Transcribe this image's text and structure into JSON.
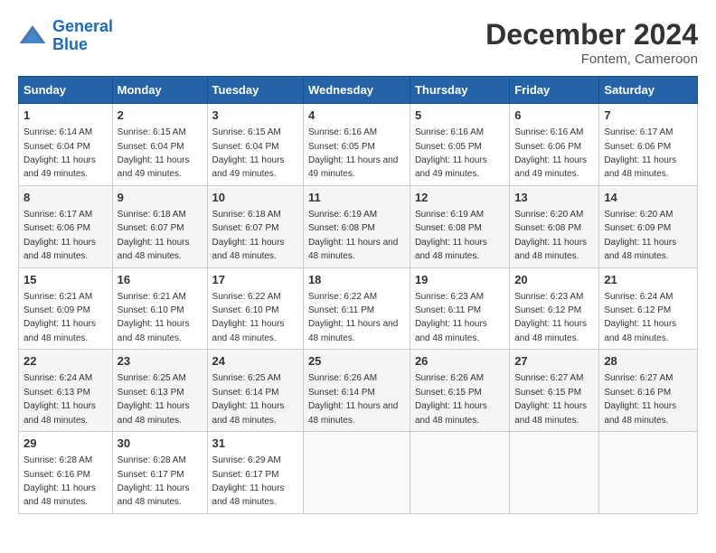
{
  "header": {
    "logo_line1": "General",
    "logo_line2": "Blue",
    "month_title": "December 2024",
    "location": "Fontem, Cameroon"
  },
  "weekdays": [
    "Sunday",
    "Monday",
    "Tuesday",
    "Wednesday",
    "Thursday",
    "Friday",
    "Saturday"
  ],
  "weeks": [
    [
      {
        "day": 1,
        "sunrise": "6:14 AM",
        "sunset": "6:04 PM",
        "daylight": "11 hours and 49 minutes."
      },
      {
        "day": 2,
        "sunrise": "6:15 AM",
        "sunset": "6:04 PM",
        "daylight": "11 hours and 49 minutes."
      },
      {
        "day": 3,
        "sunrise": "6:15 AM",
        "sunset": "6:04 PM",
        "daylight": "11 hours and 49 minutes."
      },
      {
        "day": 4,
        "sunrise": "6:16 AM",
        "sunset": "6:05 PM",
        "daylight": "11 hours and 49 minutes."
      },
      {
        "day": 5,
        "sunrise": "6:16 AM",
        "sunset": "6:05 PM",
        "daylight": "11 hours and 49 minutes."
      },
      {
        "day": 6,
        "sunrise": "6:16 AM",
        "sunset": "6:06 PM",
        "daylight": "11 hours and 49 minutes."
      },
      {
        "day": 7,
        "sunrise": "6:17 AM",
        "sunset": "6:06 PM",
        "daylight": "11 hours and 48 minutes."
      }
    ],
    [
      {
        "day": 8,
        "sunrise": "6:17 AM",
        "sunset": "6:06 PM",
        "daylight": "11 hours and 48 minutes."
      },
      {
        "day": 9,
        "sunrise": "6:18 AM",
        "sunset": "6:07 PM",
        "daylight": "11 hours and 48 minutes."
      },
      {
        "day": 10,
        "sunrise": "6:18 AM",
        "sunset": "6:07 PM",
        "daylight": "11 hours and 48 minutes."
      },
      {
        "day": 11,
        "sunrise": "6:19 AM",
        "sunset": "6:08 PM",
        "daylight": "11 hours and 48 minutes."
      },
      {
        "day": 12,
        "sunrise": "6:19 AM",
        "sunset": "6:08 PM",
        "daylight": "11 hours and 48 minutes."
      },
      {
        "day": 13,
        "sunrise": "6:20 AM",
        "sunset": "6:08 PM",
        "daylight": "11 hours and 48 minutes."
      },
      {
        "day": 14,
        "sunrise": "6:20 AM",
        "sunset": "6:09 PM",
        "daylight": "11 hours and 48 minutes."
      }
    ],
    [
      {
        "day": 15,
        "sunrise": "6:21 AM",
        "sunset": "6:09 PM",
        "daylight": "11 hours and 48 minutes."
      },
      {
        "day": 16,
        "sunrise": "6:21 AM",
        "sunset": "6:10 PM",
        "daylight": "11 hours and 48 minutes."
      },
      {
        "day": 17,
        "sunrise": "6:22 AM",
        "sunset": "6:10 PM",
        "daylight": "11 hours and 48 minutes."
      },
      {
        "day": 18,
        "sunrise": "6:22 AM",
        "sunset": "6:11 PM",
        "daylight": "11 hours and 48 minutes."
      },
      {
        "day": 19,
        "sunrise": "6:23 AM",
        "sunset": "6:11 PM",
        "daylight": "11 hours and 48 minutes."
      },
      {
        "day": 20,
        "sunrise": "6:23 AM",
        "sunset": "6:12 PM",
        "daylight": "11 hours and 48 minutes."
      },
      {
        "day": 21,
        "sunrise": "6:24 AM",
        "sunset": "6:12 PM",
        "daylight": "11 hours and 48 minutes."
      }
    ],
    [
      {
        "day": 22,
        "sunrise": "6:24 AM",
        "sunset": "6:13 PM",
        "daylight": "11 hours and 48 minutes."
      },
      {
        "day": 23,
        "sunrise": "6:25 AM",
        "sunset": "6:13 PM",
        "daylight": "11 hours and 48 minutes."
      },
      {
        "day": 24,
        "sunrise": "6:25 AM",
        "sunset": "6:14 PM",
        "daylight": "11 hours and 48 minutes."
      },
      {
        "day": 25,
        "sunrise": "6:26 AM",
        "sunset": "6:14 PM",
        "daylight": "11 hours and 48 minutes."
      },
      {
        "day": 26,
        "sunrise": "6:26 AM",
        "sunset": "6:15 PM",
        "daylight": "11 hours and 48 minutes."
      },
      {
        "day": 27,
        "sunrise": "6:27 AM",
        "sunset": "6:15 PM",
        "daylight": "11 hours and 48 minutes."
      },
      {
        "day": 28,
        "sunrise": "6:27 AM",
        "sunset": "6:16 PM",
        "daylight": "11 hours and 48 minutes."
      }
    ],
    [
      {
        "day": 29,
        "sunrise": "6:28 AM",
        "sunset": "6:16 PM",
        "daylight": "11 hours and 48 minutes."
      },
      {
        "day": 30,
        "sunrise": "6:28 AM",
        "sunset": "6:17 PM",
        "daylight": "11 hours and 48 minutes."
      },
      {
        "day": 31,
        "sunrise": "6:29 AM",
        "sunset": "6:17 PM",
        "daylight": "11 hours and 48 minutes."
      },
      null,
      null,
      null,
      null
    ]
  ]
}
